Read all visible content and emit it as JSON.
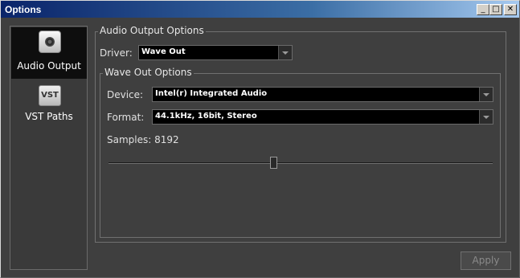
{
  "window": {
    "title": "Options",
    "controls": {
      "minimize": "_",
      "maximize": "□",
      "close": "✕"
    }
  },
  "sidebar": {
    "items": [
      {
        "label": "Audio Output",
        "icon": "speaker-icon",
        "active": true
      },
      {
        "label": "VST Paths",
        "icon": "vst-icon",
        "icon_text": "VST",
        "active": false
      }
    ]
  },
  "audio_output": {
    "group_title": "Audio Output Options",
    "driver_label": "Driver:",
    "driver_value": "Wave Out",
    "wave_out": {
      "group_title": "Wave Out Options",
      "device_label": "Device:",
      "device_value": "Intel(r) Integrated Audio",
      "format_label": "Format:",
      "format_value": "44.1kHz, 16bit, Stereo",
      "samples_label": "Samples: 8192",
      "samples_slider_position": 0.43
    }
  },
  "footer": {
    "apply_label": "Apply",
    "apply_enabled": false
  }
}
